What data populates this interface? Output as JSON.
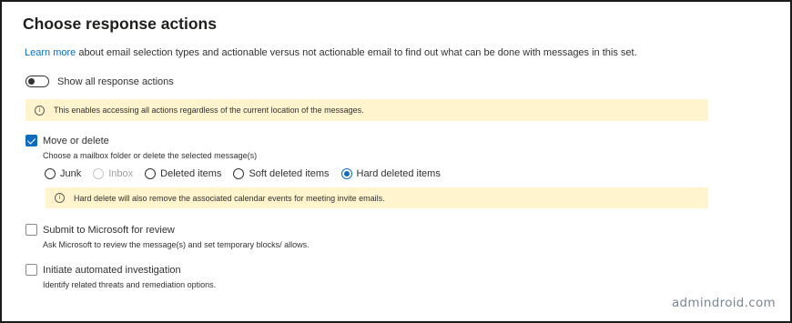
{
  "title": "Choose response actions",
  "intro": {
    "link": "Learn more",
    "text": " about email selection types and actionable versus not actionable email to find out what can be done with messages in this set."
  },
  "show_all": {
    "label": "Show all response actions",
    "on": false
  },
  "banner_all": "This enables accessing all actions regardless of the current location of the messages.",
  "move_delete": {
    "label": "Move or delete",
    "checked": true,
    "description": "Choose a mailbox folder or delete the selected message(s)",
    "options": [
      {
        "label": "Junk",
        "selected": false,
        "disabled": false
      },
      {
        "label": "Inbox",
        "selected": false,
        "disabled": true
      },
      {
        "label": "Deleted items",
        "selected": false,
        "disabled": false
      },
      {
        "label": "Soft deleted items",
        "selected": false,
        "disabled": false
      },
      {
        "label": "Hard deleted items",
        "selected": true,
        "disabled": false
      }
    ],
    "warning": "Hard delete will also remove the associated calendar events for meeting invite emails."
  },
  "submit": {
    "label": "Submit to Microsoft for review",
    "checked": false,
    "description": "Ask Microsoft to review the message(s) and set temporary blocks/ allows."
  },
  "investigate": {
    "label": "Initiate automated investigation",
    "checked": false,
    "description": "Identify related threats and remediation options."
  },
  "watermark": "admindroid.com",
  "colors": {
    "accent": "#0f6cbd",
    "banner": "#fff4ce"
  }
}
